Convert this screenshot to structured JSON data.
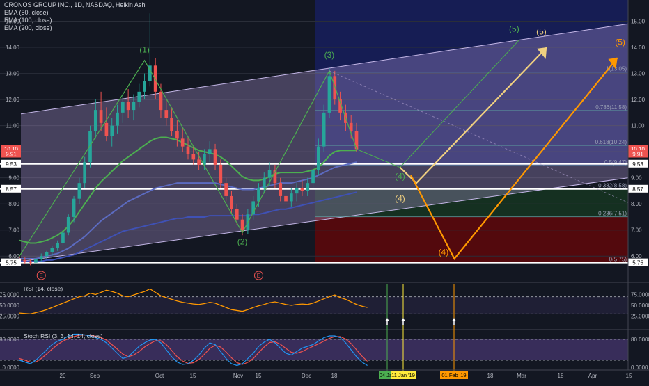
{
  "header": {
    "title": "CRONOS GROUP INC., 1D, NASDAQ, Heikin Ashi",
    "indicators": [
      "EMA (50, close)",
      "EMA (100, close)",
      "EMA (200, close)"
    ]
  },
  "colors": {
    "background": "#131722",
    "up_candle": "#26a69a",
    "down_candle": "#ef5350",
    "ema50": "#4caf50",
    "ema100": "#5c6bc0",
    "ema200": "#3f51b5",
    "channel_fill": "#b39ddb",
    "wave_green": "#4caf50",
    "wave_yellow": "#f0d080",
    "wave_orange": "#ff9800",
    "fib_dark_blue": "#1a237e",
    "fib_dark_red": "#7f0000",
    "rsi_line": "#ff9800",
    "stoch_k": "#2196f3",
    "stoch_d": "#ef5350"
  },
  "chart_data": {
    "type": "candlestick",
    "price_axis": {
      "ticks": [
        "15.00",
        "14.00",
        "13.00",
        "12.00",
        "11.00",
        "10.00",
        "9.00",
        "8.00",
        "7.00",
        "6.00"
      ],
      "ylim": [
        5.5,
        15.6
      ]
    },
    "time_axis": {
      "ticks": [
        "20",
        "Sep",
        "Oct",
        "15",
        "Nov",
        "15",
        "Dec",
        "18",
        "Feb",
        "18",
        "Mar",
        "18",
        "Apr",
        "15"
      ]
    },
    "price_labels": [
      {
        "text": "10.10",
        "value": 10.1,
        "color": "#ef5350"
      },
      {
        "text": "9.91",
        "value": 9.91,
        "color": "#ef5350"
      },
      {
        "text": "9.53",
        "value": 9.53,
        "color": "#ffffff"
      },
      {
        "text": "8.57",
        "value": 8.57,
        "color": "#ffffff"
      },
      {
        "text": "5.75",
        "value": 5.75,
        "color": "#ffffff"
      }
    ],
    "horizontal_lines": [
      9.53,
      8.57,
      5.75
    ],
    "fib_levels": [
      {
        "label": "1(13.05)",
        "value": 13.05
      },
      {
        "label": "0.786(11.58)",
        "value": 11.58
      },
      {
        "label": "0.618(10.24)",
        "value": 10.24
      },
      {
        "label": "0.5(9.47)",
        "value": 9.47
      },
      {
        "label": "0.382(8.58)",
        "value": 8.58
      },
      {
        "label": "0.236(7.51)",
        "value": 7.51
      },
      {
        "label": "0(5.75)",
        "value": 5.75
      }
    ],
    "wave_labels": [
      {
        "text": "(1)",
        "color": "green",
        "x": 33,
        "y": 13.8
      },
      {
        "text": "(2)",
        "color": "green",
        "x": 85,
        "y": 6.45
      },
      {
        "text": "(3)",
        "color": "green",
        "x": 120,
        "y": 13.6
      },
      {
        "text": "(4)",
        "color": "green",
        "x": 145,
        "y": 8.95
      },
      {
        "text": "(5)",
        "color": "green",
        "x": 189,
        "y": 14.6
      },
      {
        "text": "(4)",
        "color": "yellow",
        "x": 145,
        "y": 8.1
      },
      {
        "text": "(5)",
        "color": "yellow",
        "x": 201,
        "y": 14.5
      },
      {
        "text": "(4)",
        "color": "orange",
        "x": 160,
        "y": 6.05
      },
      {
        "text": "(5)",
        "color": "orange",
        "x": 230,
        "y": 14.1
      }
    ],
    "earnings_markers": [
      "E",
      "E"
    ],
    "candles": [
      [
        5.9,
        6.0,
        5.7,
        5.85
      ],
      [
        5.85,
        5.95,
        5.7,
        5.8
      ],
      [
        5.8,
        5.9,
        5.65,
        5.75
      ],
      [
        5.75,
        5.95,
        5.7,
        5.9
      ],
      [
        5.9,
        6.1,
        5.8,
        6.0
      ],
      [
        6.0,
        6.2,
        5.9,
        6.15
      ],
      [
        6.15,
        6.4,
        6.0,
        6.3
      ],
      [
        6.3,
        6.6,
        6.2,
        6.5
      ],
      [
        6.5,
        7.0,
        6.4,
        6.9
      ],
      [
        6.9,
        7.6,
        6.8,
        7.5
      ],
      [
        7.5,
        8.3,
        7.3,
        8.2
      ],
      [
        8.2,
        9.0,
        8.0,
        8.8
      ],
      [
        8.8,
        9.8,
        8.6,
        9.6
      ],
      [
        9.6,
        11.0,
        9.4,
        10.8
      ],
      [
        10.8,
        12.0,
        10.5,
        11.6
      ],
      [
        11.6,
        12.3,
        10.8,
        11.1
      ],
      [
        11.1,
        11.7,
        10.4,
        10.6
      ],
      [
        10.6,
        11.3,
        10.2,
        11.0
      ],
      [
        11.0,
        11.8,
        10.7,
        11.5
      ],
      [
        11.5,
        12.2,
        11.1,
        11.9
      ],
      [
        11.9,
        12.4,
        11.3,
        11.6
      ],
      [
        11.6,
        12.2,
        11.2,
        11.9
      ],
      [
        11.9,
        12.6,
        11.7,
        12.3
      ],
      [
        12.3,
        13.0,
        12.0,
        12.7
      ],
      [
        12.7,
        15.3,
        12.5,
        13.3
      ],
      [
        13.3,
        13.6,
        12.0,
        12.3
      ],
      [
        12.3,
        12.6,
        11.3,
        11.6
      ],
      [
        11.6,
        12.0,
        11.0,
        11.3
      ],
      [
        11.3,
        11.7,
        10.6,
        10.8
      ],
      [
        10.8,
        11.2,
        10.2,
        10.5
      ],
      [
        10.5,
        10.9,
        10.0,
        10.2
      ],
      [
        10.2,
        10.6,
        9.7,
        9.9
      ],
      [
        9.9,
        10.2,
        9.5,
        9.7
      ],
      [
        9.7,
        10.0,
        9.3,
        9.5
      ],
      [
        9.5,
        10.1,
        9.3,
        9.9
      ],
      [
        9.9,
        10.4,
        9.6,
        10.1
      ],
      [
        10.1,
        10.3,
        9.3,
        9.5
      ],
      [
        9.5,
        9.7,
        8.6,
        8.8
      ],
      [
        8.8,
        9.0,
        8.1,
        8.3
      ],
      [
        8.3,
        8.5,
        7.6,
        7.8
      ],
      [
        7.8,
        8.0,
        7.2,
        7.4
      ],
      [
        7.4,
        7.6,
        6.8,
        7.0
      ],
      [
        7.0,
        7.8,
        6.85,
        7.6
      ],
      [
        7.6,
        8.3,
        7.4,
        8.1
      ],
      [
        8.1,
        8.8,
        7.9,
        8.6
      ],
      [
        8.6,
        9.2,
        8.4,
        9.0
      ],
      [
        9.0,
        9.6,
        8.7,
        9.3
      ],
      [
        9.3,
        9.5,
        8.6,
        8.8
      ],
      [
        8.8,
        9.0,
        8.1,
        8.3
      ],
      [
        8.3,
        8.6,
        7.9,
        8.1
      ],
      [
        8.1,
        8.6,
        7.9,
        8.4
      ],
      [
        8.4,
        8.8,
        8.1,
        8.6
      ],
      [
        8.6,
        8.9,
        8.3,
        8.5
      ],
      [
        8.5,
        9.0,
        8.3,
        8.8
      ],
      [
        8.8,
        9.5,
        8.6,
        9.3
      ],
      [
        9.3,
        10.5,
        9.1,
        10.2
      ],
      [
        10.2,
        11.8,
        10.0,
        11.5
      ],
      [
        11.5,
        13.2,
        11.3,
        12.9
      ],
      [
        12.9,
        13.1,
        11.8,
        12.0
      ],
      [
        12.0,
        12.3,
        11.2,
        11.5
      ],
      [
        11.5,
        11.8,
        10.8,
        11.1
      ],
      [
        11.1,
        11.4,
        10.5,
        10.8
      ],
      [
        10.8,
        11.1,
        10.0,
        10.1
      ]
    ],
    "ema50": [
      6.6,
      6.55,
      6.5,
      6.5,
      6.55,
      6.6,
      6.7,
      6.8,
      6.95,
      7.15,
      7.4,
      7.7,
      8.0,
      8.3,
      8.6,
      8.85,
      9.05,
      9.25,
      9.45,
      9.65,
      9.8,
      9.95,
      10.1,
      10.25,
      10.4,
      10.5,
      10.55,
      10.55,
      10.5,
      10.45,
      10.35,
      10.25,
      10.15,
      10.05,
      10.0,
      9.95,
      9.9,
      9.8,
      9.65,
      9.45,
      9.25,
      9.05,
      8.95,
      8.9,
      8.9,
      8.95,
      9.05,
      9.15,
      9.2,
      9.2,
      9.2,
      9.2,
      9.2,
      9.25,
      9.3,
      9.4,
      9.6,
      9.85,
      10.0,
      10.05,
      10.05,
      10.05,
      10.05
    ],
    "ema100": [
      5.9,
      5.9,
      5.9,
      5.9,
      5.95,
      6.0,
      6.05,
      6.1,
      6.2,
      6.3,
      6.45,
      6.6,
      6.75,
      6.95,
      7.15,
      7.35,
      7.5,
      7.65,
      7.8,
      7.95,
      8.1,
      8.2,
      8.3,
      8.4,
      8.5,
      8.6,
      8.65,
      8.7,
      8.75,
      8.8,
      8.8,
      8.8,
      8.8,
      8.8,
      8.8,
      8.8,
      8.8,
      8.75,
      8.7,
      8.65,
      8.6,
      8.55,
      8.55,
      8.55,
      8.6,
      8.65,
      8.7,
      8.75,
      8.8,
      8.8,
      8.8,
      8.85,
      8.9,
      8.95,
      9.0,
      9.1,
      9.2,
      9.3,
      9.4,
      9.45,
      9.5,
      9.55,
      9.6
    ],
    "ema200": [
      5.8,
      5.8,
      5.8,
      5.8,
      5.8,
      5.85,
      5.85,
      5.9,
      5.95,
      6.0,
      6.05,
      6.15,
      6.25,
      6.35,
      6.45,
      6.55,
      6.65,
      6.75,
      6.85,
      6.95,
      7.0,
      7.05,
      7.1,
      7.15,
      7.2,
      7.25,
      7.3,
      7.35,
      7.4,
      7.45,
      7.45,
      7.5,
      7.5,
      7.5,
      7.5,
      7.55,
      7.55,
      7.55,
      7.55,
      7.55,
      7.55,
      7.55,
      7.55,
      7.6,
      7.6,
      7.65,
      7.7,
      7.75,
      7.8,
      7.8,
      7.85,
      7.9,
      7.95,
      8.0,
      8.05,
      8.1,
      8.15,
      8.2,
      8.25,
      8.3,
      8.35,
      8.4,
      8.45
    ],
    "rsi": {
      "label": "RSI (14, close)",
      "ticks": [
        "75.0000",
        "50.0000",
        "25.0000"
      ],
      "values": [
        32,
        31,
        30,
        33,
        36,
        40,
        45,
        50,
        55,
        60,
        65,
        70,
        72,
        78,
        75,
        80,
        85,
        82,
        78,
        72,
        70,
        74,
        78,
        82,
        88,
        80,
        72,
        68,
        64,
        60,
        57,
        55,
        53,
        52,
        54,
        57,
        55,
        50,
        45,
        40,
        38,
        36,
        40,
        45,
        49,
        52,
        56,
        58,
        55,
        52,
        50,
        52,
        53,
        52,
        55,
        60,
        65,
        70,
        74,
        68,
        64,
        58,
        52,
        48,
        45
      ]
    },
    "stoch_rsi": {
      "label": "Stoch RSI (3, 3, 14, 14, close)",
      "ticks": [
        "80.0000",
        "0.0000"
      ],
      "k": [
        20,
        15,
        10,
        20,
        35,
        50,
        65,
        75,
        80,
        90,
        95,
        95,
        93,
        90,
        85,
        80,
        70,
        55,
        40,
        25,
        30,
        45,
        60,
        70,
        78,
        80,
        70,
        50,
        30,
        15,
        8,
        10,
        20,
        35,
        55,
        70,
        65,
        45,
        25,
        10,
        5,
        10,
        25,
        40,
        60,
        72,
        80,
        70,
        55,
        40,
        35,
        45,
        55,
        60,
        65,
        75,
        85,
        90,
        90,
        85,
        70,
        50,
        30,
        15,
        5
      ],
      "d": [
        25,
        20,
        15,
        15,
        25,
        38,
        52,
        65,
        75,
        82,
        88,
        92,
        93,
        92,
        89,
        85,
        78,
        65,
        52,
        38,
        30,
        35,
        45,
        58,
        68,
        76,
        76,
        65,
        48,
        30,
        18,
        11,
        13,
        22,
        37,
        54,
        63,
        58,
        44,
        27,
        13,
        8,
        14,
        25,
        42,
        58,
        71,
        73,
        66,
        54,
        43,
        40,
        45,
        53,
        60,
        67,
        75,
        83,
        88,
        88,
        81,
        68,
        50,
        32,
        17
      ]
    },
    "date_markers": [
      {
        "text": "04 Jan",
        "color": "#4caf50"
      },
      {
        "text": "11 Jan '19",
        "color": "#ffeb3b"
      },
      {
        "text": "01 Feb '19",
        "color": "#ff9800"
      }
    ]
  }
}
